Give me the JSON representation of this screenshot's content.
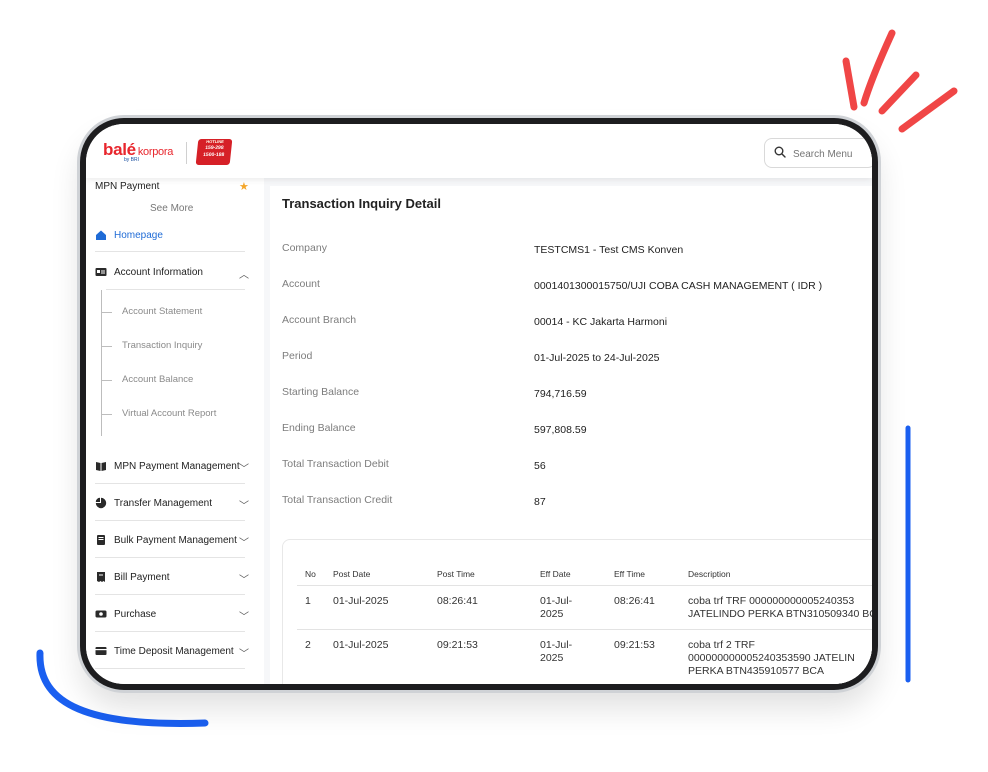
{
  "app": {
    "logo_brand": "balé",
    "logo_sub": "korpora",
    "logo_by": "by BRI",
    "hotline_top": "HOTLINE",
    "hotline_line1": "159-298",
    "hotline_line2": "1500-188"
  },
  "search": {
    "placeholder": "Search Menu"
  },
  "sidebar": {
    "favorite": "MPN Payment",
    "see_more": "See More",
    "home": "Homepage",
    "account_info": "Account Information",
    "sub_items": [
      "Account Statement",
      "Transaction Inquiry",
      "Account Balance",
      "Virtual Account Report"
    ],
    "menus": [
      "MPN Payment Management",
      "Transfer Management",
      "Bulk Payment Management",
      "Bill Payment",
      "Purchase",
      "Time Deposit Management"
    ]
  },
  "detail": {
    "title": "Transaction Inquiry Detail",
    "fields": [
      {
        "label": "Company",
        "value": "TESTCMS1 - Test CMS Konven"
      },
      {
        "label": "Account",
        "value": "0001401300015750/UJI COBA CASH MANAGEMENT ( IDR )"
      },
      {
        "label": "Account Branch",
        "value": "00014 - KC Jakarta Harmoni"
      },
      {
        "label": "Period",
        "value": "01-Jul-2025 to 24-Jul-2025"
      },
      {
        "label": "Starting Balance",
        "value": "794,716.59"
      },
      {
        "label": "Ending Balance",
        "value": "597,808.59"
      },
      {
        "label": "Total Transaction Debit",
        "value": "56"
      },
      {
        "label": "Total Transaction Credit",
        "value": "87"
      }
    ]
  },
  "table": {
    "headers": [
      "No",
      "Post Date",
      "Post Time",
      "Eff Date",
      "Eff Time",
      "Description"
    ],
    "rows": [
      {
        "no": "1",
        "post_date": "01-Jul-2025",
        "post_time": "08:26:41",
        "eff_date_1": "01-Jul-",
        "eff_date_2": "2025",
        "eff_time": "08:26:41",
        "desc_1": "coba trf TRF 000000000005240353",
        "desc_2": "JATELINDO PERKA BTN310509340 BC"
      },
      {
        "no": "2",
        "post_date": "01-Jul-2025",
        "post_time": "09:21:53",
        "eff_date_1": "01-Jul-",
        "eff_date_2": "2025",
        "eff_time": "09:21:53",
        "desc_1": "coba trf 2 TRF",
        "desc_2": "000000000005240353590 JATELIN",
        "desc_3": "PERKA BTN435910577 BCA"
      }
    ]
  },
  "colors": {
    "accent_red": "#e8262d",
    "accent_blue": "#1f6bd6",
    "deco_blue": "#1a5ff0",
    "deco_red": "#f04646"
  }
}
